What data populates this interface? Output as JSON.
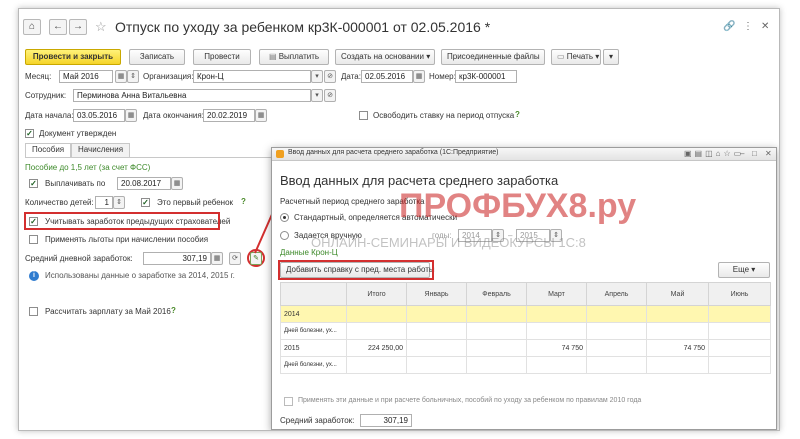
{
  "header": {
    "home_glyph": "⌂",
    "back_glyph": "←",
    "forward_glyph": "→",
    "star_glyph": "☆",
    "title": "Отпуск по уходу за ребенком кр3К-000001 от 02.05.2016 *",
    "link_glyph": "🔗",
    "more_glyph": "⋮",
    "close_glyph": "✕"
  },
  "toolbar": {
    "post_close": "Провести и закрыть",
    "save": "Записать",
    "post": "Провести",
    "pay": "Выплатить",
    "create_based": "Создать на основании",
    "attached": "Присоединенные файлы",
    "print": "Печать"
  },
  "form": {
    "month_label": "Месяц:",
    "month_value": "Май 2016",
    "org_label": "Организация:",
    "org_value": "Крон-Ц",
    "date_label": "Дата:",
    "date_value": "02.05.2016",
    "number_label": "Номер:",
    "number_value": "кр3К-000001",
    "employee_label": "Сотрудник:",
    "employee_value": "Перминова Анна Витальевна",
    "start_label": "Дата начала:",
    "start_value": "03.05.2016",
    "end_label": "Дата окончания:",
    "end_value": "20.02.2019",
    "free_rate_label": "Освободить ставку на период отпуска",
    "approved_label": "Документ утвержден",
    "help_glyph": "?"
  },
  "tabs": {
    "benefits": "Пособия",
    "accruals": "Начисления"
  },
  "benefits": {
    "section_title": "Пособие до 1,5 лет (за счет ФСС)",
    "pay_until_label": "Выплачивать по",
    "pay_until_value": "20.08.2017",
    "children_label": "Количество детей:",
    "children_value": "1",
    "first_child_label": "Это первый ребенок",
    "prev_earnings_label": "Учитывать заработок предыдущих страхователей",
    "apply_benefits_label": "Применять льготы при начислении пособия",
    "avg_daily_label": "Средний дневной заработок:",
    "avg_daily_value": "307,19",
    "used_data_note": "Использованы данные о заработке за 2014, 2015 г.",
    "info_glyph": "i",
    "recalc_label": "Рассчитать зарплату за Май 2016",
    "refresh_glyph": "⟳",
    "edit_glyph": "✎"
  },
  "modal": {
    "titlebar": "Ввод данных для расчета среднего заработка  (1С:Предприятие)",
    "heading": "Ввод данных для расчета среднего заработка",
    "period_label": "Расчетный период среднего заработка",
    "standard_label": "Стандартный, определяется автоматически",
    "manual_label": "Задается вручную",
    "years_label": "годы:",
    "year1": "2014",
    "year2": "2015",
    "org_data_label": "Данные Крон-Ц",
    "add_cert_btn": "Добавить справку с пред. места работы",
    "more_btn": "Еще",
    "columns": [
      "",
      "Итого",
      "Январь",
      "Февраль",
      "Март",
      "Апрель",
      "Май",
      "Июнь"
    ],
    "rows": [
      [
        "2014",
        "",
        "",
        "",
        "",
        "",
        "",
        ""
      ],
      [
        "Дней болезни, ух...",
        "",
        "",
        "",
        "",
        "",
        "",
        ""
      ],
      [
        "2015",
        "224 250,00",
        "",
        "",
        "74 750",
        "",
        "74 750",
        ""
      ],
      [
        "Дней болезни, ух...",
        "",
        "",
        "",
        "",
        "",
        "",
        ""
      ]
    ],
    "apply_note": "Применять эти данные и при расчете больничных, пособий по уходу за ребенком по правилам 2010 года",
    "avg_label": "Средний заработок:",
    "avg_value": "307,19"
  },
  "watermark": {
    "brand": "ПРОФБУХ8.ру",
    "tagline": "ОНЛАЙН-СЕМИНАРЫ И ВИДЕОКУРСЫ 1С:8"
  },
  "colors": {
    "accent_yellow": "#f5d429",
    "highlight_row": "#fff7b0",
    "annotation_red": "#d32f2f",
    "help_green": "#4a8a2a"
  }
}
